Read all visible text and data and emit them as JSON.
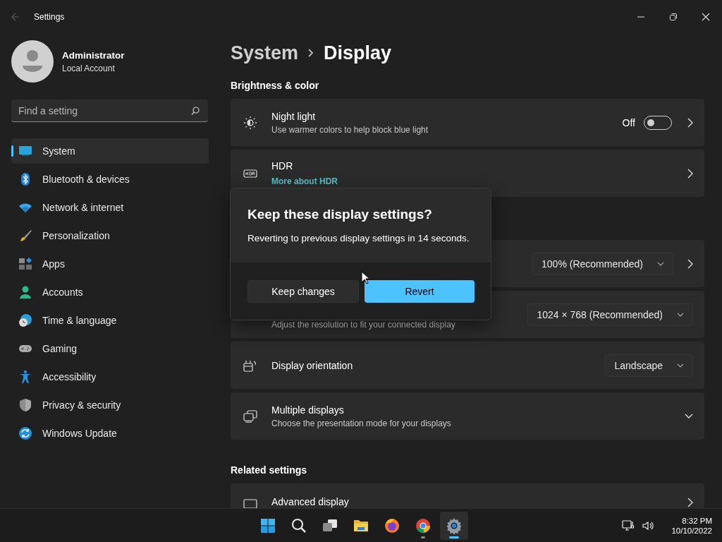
{
  "window": {
    "title": "Settings"
  },
  "account": {
    "name": "Administrator",
    "subtitle": "Local Account"
  },
  "search": {
    "placeholder": "Find a setting"
  },
  "sidebar": {
    "items": [
      {
        "label": "System",
        "selected": true
      },
      {
        "label": "Bluetooth & devices",
        "selected": false
      },
      {
        "label": "Network & internet",
        "selected": false
      },
      {
        "label": "Personalization",
        "selected": false
      },
      {
        "label": "Apps",
        "selected": false
      },
      {
        "label": "Accounts",
        "selected": false
      },
      {
        "label": "Time & language",
        "selected": false
      },
      {
        "label": "Gaming",
        "selected": false
      },
      {
        "label": "Accessibility",
        "selected": false
      },
      {
        "label": "Privacy & security",
        "selected": false
      },
      {
        "label": "Windows Update",
        "selected": false
      }
    ]
  },
  "breadcrumb": [
    "System",
    "Display"
  ],
  "sections": [
    {
      "heading": "Brightness & color",
      "cards": [
        {
          "kind": "toggle",
          "title": "Night light",
          "subtitle": "Use warmer colors to help block blue light",
          "state_label": "Off",
          "on": false,
          "navigates": true
        },
        {
          "kind": "link",
          "title": "HDR",
          "link": "More about HDR",
          "navigates": true
        }
      ]
    },
    {
      "cards": [
        {
          "kind": "dropdown",
          "value": "100% (Recommended)",
          "navigates": true
        },
        {
          "kind": "dropdown",
          "subtitle": "Adjust the resolution to fit your connected display",
          "value": "1024 × 768 (Recommended)",
          "navigates": false
        },
        {
          "kind": "dropdown",
          "title": "Display orientation",
          "value": "Landscape",
          "navigates": false
        },
        {
          "kind": "expander",
          "title": "Multiple displays",
          "subtitle": "Choose the presentation mode for your displays",
          "expanded": false
        }
      ]
    },
    {
      "heading": "Related settings",
      "cards": [
        {
          "kind": "nav",
          "title": "Advanced display",
          "navigates": true
        }
      ]
    }
  ],
  "dialog": {
    "title": "Keep these display settings?",
    "message": "Reverting to previous display settings in 14 seconds.",
    "buttons": [
      {
        "label": "Keep changes",
        "kind": "secondary"
      },
      {
        "label": "Revert",
        "kind": "primary"
      }
    ]
  },
  "taskbar": {
    "items": [
      {
        "running": false,
        "selected": false
      },
      {
        "running": false,
        "selected": false
      },
      {
        "running": false,
        "selected": false
      },
      {
        "running": false,
        "selected": false
      },
      {
        "running": false,
        "selected": false
      },
      {
        "running": true,
        "selected": false
      },
      {
        "running": true,
        "selected": true
      }
    ],
    "time": "8:32 PM",
    "date": "10/10/2022"
  }
}
